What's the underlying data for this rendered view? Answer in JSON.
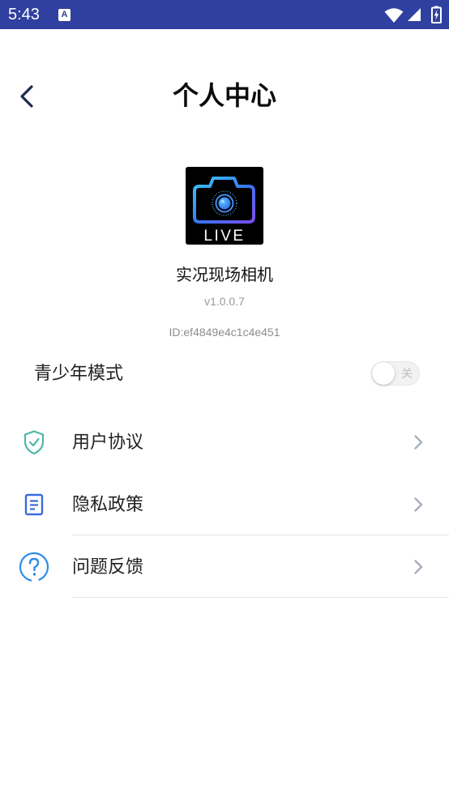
{
  "status_bar": {
    "time": "5:43",
    "notification_letter": "A",
    "icons": [
      "a-notification-icon",
      "wifi-icon",
      "signal-icon",
      "battery-charging-icon"
    ]
  },
  "header": {
    "title": "个人中心",
    "back_icon": "back-chevron-icon"
  },
  "app": {
    "logo_text": "LIVE",
    "logo_icon": "camera-icon",
    "name": "实况现场相机",
    "version": "v1.0.0.7",
    "id": "ID:ef4849e4c1c4e451"
  },
  "teen_mode": {
    "label": "青少年模式",
    "toggle_label": "关",
    "enabled": false
  },
  "menu": {
    "items": [
      {
        "label": "用户协议",
        "icon": "shield-check-icon"
      },
      {
        "label": "隐私政策",
        "icon": "document-icon"
      },
      {
        "label": "问题反馈",
        "icon": "question-circle-icon"
      }
    ],
    "chevron_icon": "chevron-right-icon"
  },
  "colors": {
    "status_bar": "#3040A0",
    "shield": "#4DB8A8",
    "doc": "#3A6BDB",
    "question": "#2F8CEB",
    "chevron": "#A7AFBC"
  }
}
